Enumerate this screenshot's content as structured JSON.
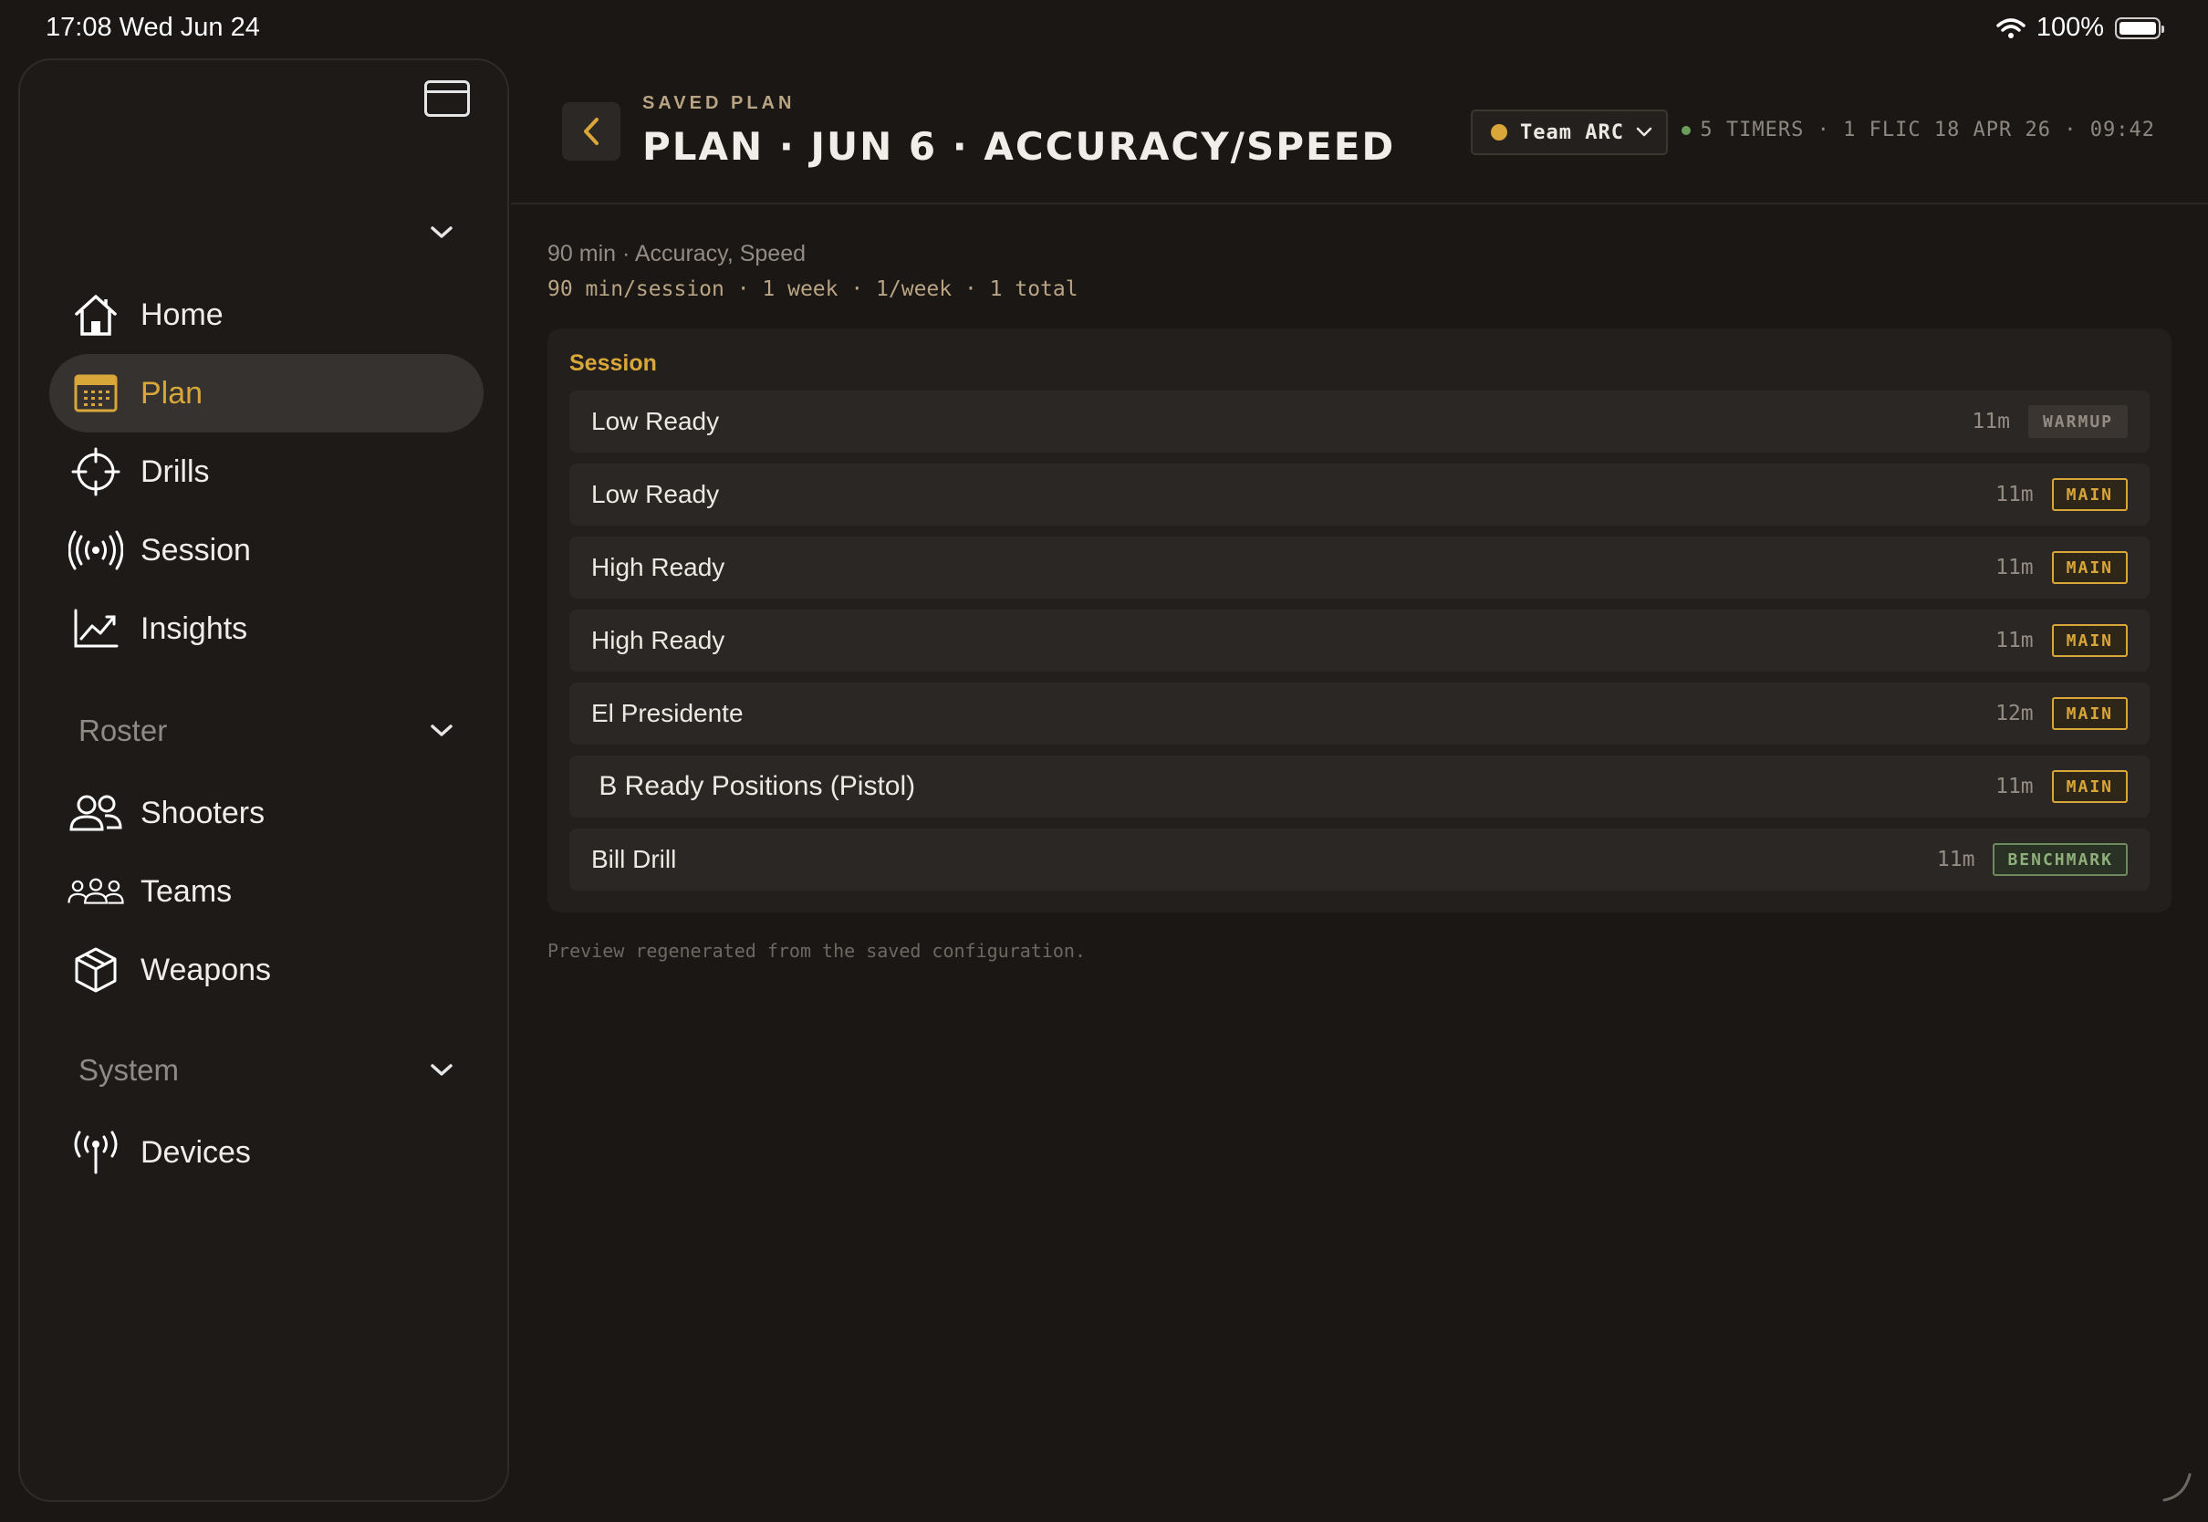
{
  "status_bar": {
    "time": "17:08   Wed Jun 24",
    "battery": "100%"
  },
  "sidebar": {
    "nav": [
      {
        "label": "Home",
        "icon": "home-icon"
      },
      {
        "label": "Plan",
        "icon": "calendar-icon",
        "active": true
      },
      {
        "label": "Drills",
        "icon": "crosshair-icon"
      },
      {
        "label": "Session",
        "icon": "broadcast-icon"
      },
      {
        "label": "Insights",
        "icon": "chart-icon"
      }
    ],
    "roster_label": "Roster",
    "roster": [
      {
        "label": "Shooters",
        "icon": "users-icon"
      },
      {
        "label": "Teams",
        "icon": "team-icon"
      },
      {
        "label": "Weapons",
        "icon": "box-icon"
      }
    ],
    "system_label": "System",
    "system": [
      {
        "label": "Devices",
        "icon": "antenna-icon"
      }
    ]
  },
  "header": {
    "eyebrow": "SAVED PLAN",
    "title": "PLAN · JUN 6 · ACCURACY/SPEED",
    "team": "Team ARC",
    "status": "5 TIMERS · 1 FLIC  18 APR 26 · 09:42"
  },
  "summary": {
    "line1": "90 min · Accuracy, Speed",
    "line2": "90 min/session · 1 week · 1/week · 1 total"
  },
  "session": {
    "title": "Session",
    "rows": [
      {
        "name": "Low Ready",
        "duration": "11m",
        "badge": "WARMUP",
        "kind": "warmup"
      },
      {
        "name": "Low Ready",
        "duration": "11m",
        "badge": "MAIN",
        "kind": "main"
      },
      {
        "name": "High Ready",
        "duration": "11m",
        "badge": "MAIN",
        "kind": "main"
      },
      {
        "name": "High Ready",
        "duration": "11m",
        "badge": "MAIN",
        "kind": "main"
      },
      {
        "name": "El Presidente",
        "duration": "12m",
        "badge": "MAIN",
        "kind": "main"
      },
      {
        "name": " B Ready Positions (Pistol)",
        "duration": "11m",
        "badge": "MAIN",
        "kind": "main"
      },
      {
        "name": "Bill Drill",
        "duration": "11m",
        "badge": "BENCHMARK",
        "kind": "benchmark"
      }
    ]
  },
  "footnote": "Preview regenerated from the saved configuration.",
  "colors": {
    "accent": "#d9a63a",
    "background": "#1a1715",
    "benchmark": "#8fb07a"
  }
}
